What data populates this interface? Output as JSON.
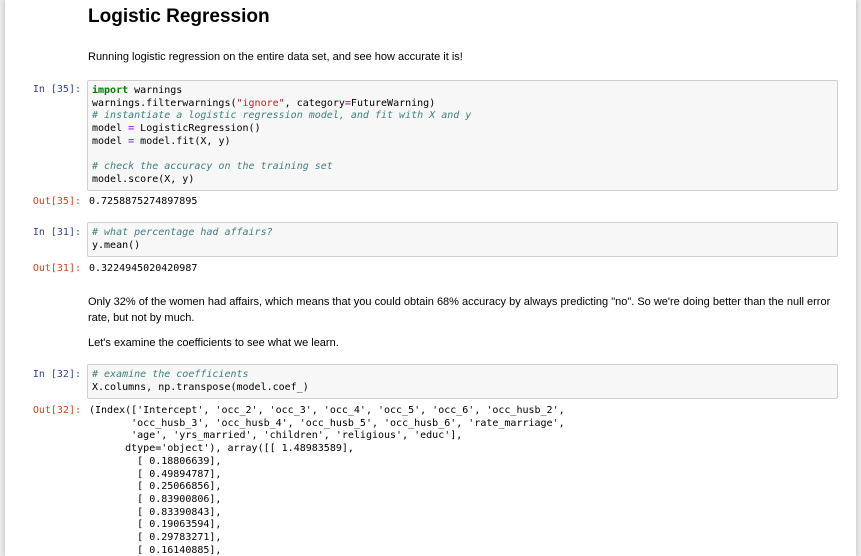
{
  "heading": "Logistic Regression",
  "intro": "Running logistic regression on the entire data set, and see how accurate it is!",
  "cells": {
    "c35": {
      "in_prompt": "In [35]:",
      "l1_kw": "import",
      "l1_rest": " warnings",
      "l2a": "warnings.filterwarnings(",
      "l2_str": "\"ignore\"",
      "l2b": ", category",
      "l2_eq": "=",
      "l2c": "FutureWarning)",
      "l3_comment": "# instantiate a logistic regression model, and fit with X and y",
      "l4a": "model ",
      "l4_eq": "=",
      "l4b": " LogisticRegression()",
      "l5a": "model ",
      "l5_eq": "=",
      "l5b": " model.fit(X, y)",
      "l6_comment": "# check the accuracy on the training set",
      "l7": "model.score(X, y)",
      "out_prompt": "Out[35]:",
      "output": "0.7258875274897895"
    },
    "c31": {
      "in_prompt": "In [31]:",
      "l1_comment": "# what percentage had affairs?",
      "l2": "y.mean()",
      "out_prompt": "Out[31]:",
      "output": "0.3224945020420987"
    },
    "c32": {
      "in_prompt": "In [32]:",
      "l1_comment": "# examine the coefficients",
      "l2": "X.columns, np.transpose(model.coef_)",
      "out_prompt": "Out[32]:",
      "output": "(Index(['Intercept', 'occ_2', 'occ_3', 'occ_4', 'occ_5', 'occ_6', 'occ_husb_2',\n       'occ_husb_3', 'occ_husb_4', 'occ_husb_5', 'occ_husb_6', 'rate_marriage',\n       'age', 'yrs_married', 'children', 'religious', 'educ'],\n      dtype='object'), array([[ 1.48983589],\n        [ 0.18806639],\n        [ 0.49894787],\n        [ 0.25066856],\n        [ 0.83900806],\n        [ 0.83390843],\n        [ 0.19063594],\n        [ 0.29783271],\n        [ 0.16140885],"
    }
  },
  "md_affairs": "Only 32% of the women had affairs, which means that you could obtain 68% accuracy by always predicting \"no\". So we're doing better than the null error rate, but not by much.",
  "md_examine": "Let's examine the coefficients to see what we learn.",
  "colors": {
    "in_prompt": "#303f9f",
    "out_prompt": "#d84315",
    "keyword": "#008000",
    "string": "#ba2121",
    "comment": "#408080",
    "operator": "#aa22ff"
  }
}
